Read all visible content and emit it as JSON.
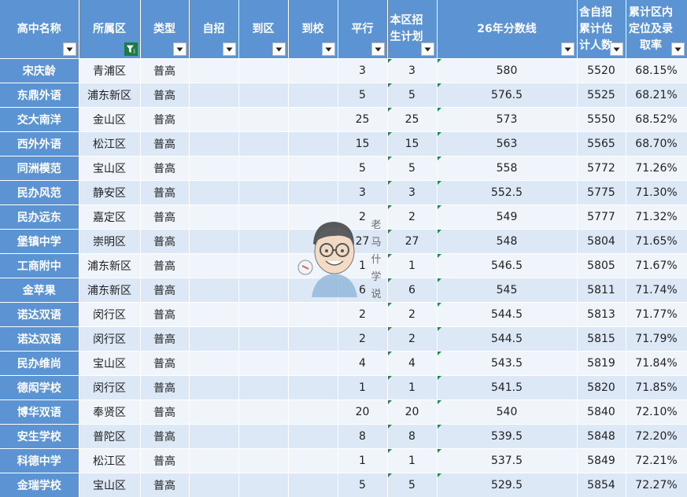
{
  "headers": [
    {
      "lines": [
        "高中名称"
      ],
      "filter": "normal"
    },
    {
      "lines": [
        "所属区"
      ],
      "filter": "active"
    },
    {
      "lines": [
        "类型"
      ],
      "filter": "normal"
    },
    {
      "lines": [
        "自招"
      ],
      "filter": "normal"
    },
    {
      "lines": [
        "到区"
      ],
      "filter": "normal"
    },
    {
      "lines": [
        "到校"
      ],
      "filter": "normal"
    },
    {
      "lines": [
        "平行"
      ],
      "filter": "normal"
    },
    {
      "lines": [
        "本区招",
        "生计划"
      ],
      "filter": "normal"
    },
    {
      "lines": [
        "26年分数线"
      ],
      "filter": "normal"
    },
    {
      "lines": [
        "含自招",
        "累计估",
        "计人数"
      ],
      "filter": "normal"
    },
    {
      "lines": [
        "累计区内",
        "定位及录",
        "取率"
      ],
      "filter": "normal"
    }
  ],
  "rows": [
    [
      "宋庆龄",
      "青浦区",
      "普高",
      "",
      "",
      "",
      "3",
      "3",
      "580",
      "5520",
      "68.15%"
    ],
    [
      "东鼎外语",
      "浦东新区",
      "普高",
      "",
      "",
      "",
      "5",
      "5",
      "576.5",
      "5525",
      "68.21%"
    ],
    [
      "交大南洋",
      "金山区",
      "普高",
      "",
      "",
      "",
      "25",
      "25",
      "573",
      "5550",
      "68.52%"
    ],
    [
      "西外外语",
      "松江区",
      "普高",
      "",
      "",
      "",
      "15",
      "15",
      "563",
      "5565",
      "68.70%"
    ],
    [
      "同洲模范",
      "宝山区",
      "普高",
      "",
      "",
      "",
      "5",
      "5",
      "558",
      "5772",
      "71.26%"
    ],
    [
      "民办风范",
      "静安区",
      "普高",
      "",
      "",
      "",
      "3",
      "3",
      "552.5",
      "5775",
      "71.30%"
    ],
    [
      "民办远东",
      "嘉定区",
      "普高",
      "",
      "",
      "",
      "2",
      "2",
      "549",
      "5777",
      "71.32%"
    ],
    [
      "堡镇中学",
      "崇明区",
      "普高",
      "",
      "",
      "",
      "27",
      "27",
      "548",
      "5804",
      "71.65%"
    ],
    [
      "工商附中",
      "浦东新区",
      "普高",
      "",
      "",
      "",
      "1",
      "1",
      "546.5",
      "5805",
      "71.67%"
    ],
    [
      "金苹果",
      "浦东新区",
      "普高",
      "",
      "",
      "",
      "6",
      "6",
      "545",
      "5811",
      "71.74%"
    ],
    [
      "诺达双语",
      "闵行区",
      "普高",
      "",
      "",
      "",
      "2",
      "2",
      "544.5",
      "5813",
      "71.77%"
    ],
    [
      "诺达双语",
      "闵行区",
      "普高",
      "",
      "",
      "",
      "2",
      "2",
      "544.5",
      "5815",
      "71.79%"
    ],
    [
      "民办维尚",
      "宝山区",
      "普高",
      "",
      "",
      "",
      "4",
      "4",
      "543.5",
      "5819",
      "71.84%"
    ],
    [
      "德闳学校",
      "闵行区",
      "普高",
      "",
      "",
      "",
      "1",
      "1",
      "541.5",
      "5820",
      "71.85%"
    ],
    [
      "博华双语",
      "奉贤区",
      "普高",
      "",
      "",
      "",
      "20",
      "20",
      "540",
      "5840",
      "72.10%"
    ],
    [
      "安生学校",
      "普陀区",
      "普高",
      "",
      "",
      "",
      "8",
      "8",
      "539.5",
      "5848",
      "72.20%"
    ],
    [
      "科德中学",
      "松江区",
      "普高",
      "",
      "",
      "",
      "1",
      "1",
      "537.5",
      "5849",
      "72.21%"
    ],
    [
      "金瑞学校",
      "宝山区",
      "普高",
      "",
      "",
      "",
      "5",
      "5",
      "529.5",
      "5854",
      "72.27%"
    ]
  ],
  "watermark": {
    "chars": [
      "老",
      "马",
      "什",
      "学",
      "说"
    ]
  },
  "colors": {
    "header": "#5b93d3",
    "row_odd": "#f0f4fb",
    "row_even": "#dde8f6",
    "filter_active": "#1e7a45",
    "cell_marker": "#1e8a4c"
  },
  "icons": {
    "filter": "chevron-down-icon",
    "filter_active": "filter-icon"
  }
}
